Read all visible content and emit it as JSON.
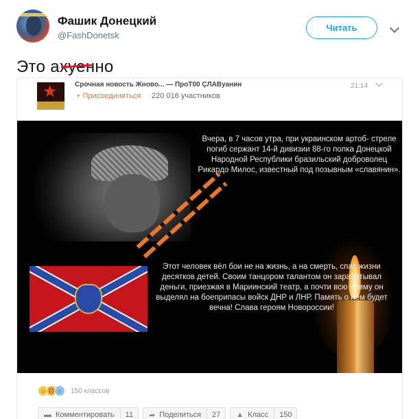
{
  "tweet": {
    "display_name": "Фашик Донецкий",
    "handle": "@FashDonetsk",
    "follow_label": "Читать",
    "text": "Это ахуенно"
  },
  "post": {
    "group_title": "Срочная новость Жново... — ПроТ00 ÇЛАВуанин",
    "join_label": "+ Присоединиться",
    "members": "220 016 участников",
    "time": "21:14",
    "text_top": "Вчера, в 7 часов утра, при украинском артоб- стреле погиб сержант 14-й дивизии 88-го полка Донецкой Народной Республики бразильский доброволец Рикардо Милос, известный под позывным «славянин».",
    "text_bottom": "Этот человек вёл бои не на жизнь, а на смерть, спас жизни десятков детей. Своим танцором талантом он зарабатывал деньги, приезжая в Мариинский театр, а почти всю сумму он выделял на боеприпасы войск ДНР и ЛНР. Память о нём будет вечна! Слава героям Новороссии!",
    "classes": "150 классов",
    "actions": {
      "comment_label": "Комментировать",
      "comment_count": "11",
      "share_label": "Поделиться",
      "share_count": "27",
      "like_label": "Класс",
      "like_count": "150"
    }
  }
}
